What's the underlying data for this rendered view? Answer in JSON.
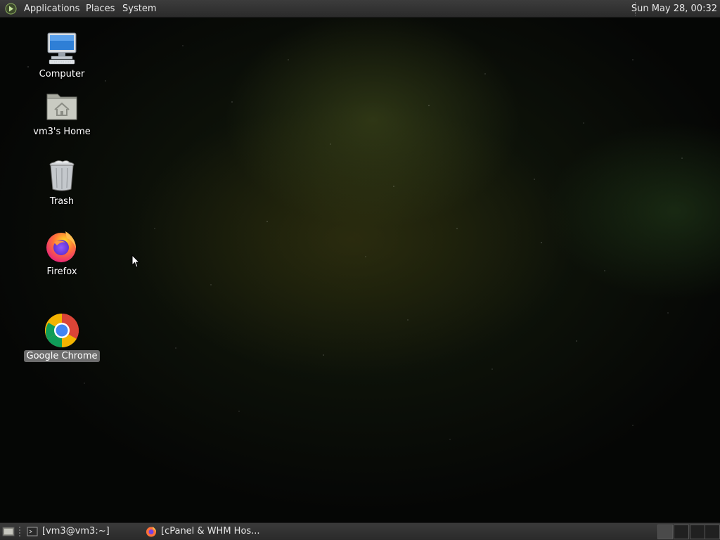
{
  "top_panel": {
    "menus": [
      "Applications",
      "Places",
      "System"
    ],
    "clock": "Sun May 28, 00:32"
  },
  "desktop": {
    "icons": [
      {
        "label": "Computer",
        "icon": "computer-icon"
      },
      {
        "label": "vm3's Home",
        "icon": "home-folder-icon"
      },
      {
        "label": "Trash",
        "icon": "trash-icon"
      },
      {
        "label": "Firefox",
        "icon": "firefox-icon"
      },
      {
        "label": "Google Chrome",
        "icon": "chrome-icon",
        "selected": true
      }
    ]
  },
  "bottom_panel": {
    "tasks": [
      {
        "label": "[vm3@vm3:~]",
        "icon": "terminal-icon"
      },
      {
        "label": "[cPanel & WHM Hos...",
        "icon": "firefox-icon"
      }
    ],
    "workspaces": 4
  },
  "colors": {
    "panel": "#2f2f2f",
    "panel_text": "#e6e6e6",
    "selection": "#6d6d6d"
  }
}
